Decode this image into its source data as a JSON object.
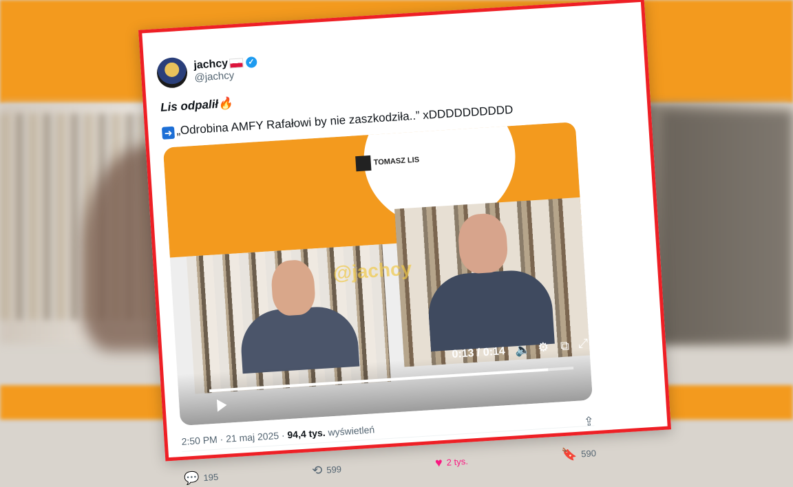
{
  "tweet": {
    "display_name": "jachcy",
    "handle": "@jachcy",
    "text_line1": "Lis odpalił",
    "text_line2": "„Odrobina AMFY Rafałowi by nie zaszkodziła..” xDDDDDDDDDD",
    "video": {
      "channel_label": "TOMASZ LIS",
      "watermark": "@jachcy",
      "time": "0:13 / 0:14",
      "progress": 0.93
    },
    "timestamp": "2:50 PM · 21 maj 2025 ·",
    "views_count": "94,4 tys.",
    "views_label": "wyświetleń",
    "replies": "195",
    "reposts": "599",
    "likes": "2 tys.",
    "bookmarks": "590"
  },
  "colors": {
    "border": "#ee1f25",
    "accent": "#1d9bf0",
    "like": "#f91880",
    "video_brand": "#f39a1e"
  },
  "icons": [
    "verified-badge-icon",
    "flag-icon",
    "fire-icon",
    "arrow-right-icon",
    "play-icon",
    "volume-icon",
    "settings-icon",
    "pip-icon",
    "fullscreen-icon",
    "reply-icon",
    "repost-icon",
    "like-icon",
    "bookmark-icon",
    "share-icon",
    "more-icon"
  ]
}
